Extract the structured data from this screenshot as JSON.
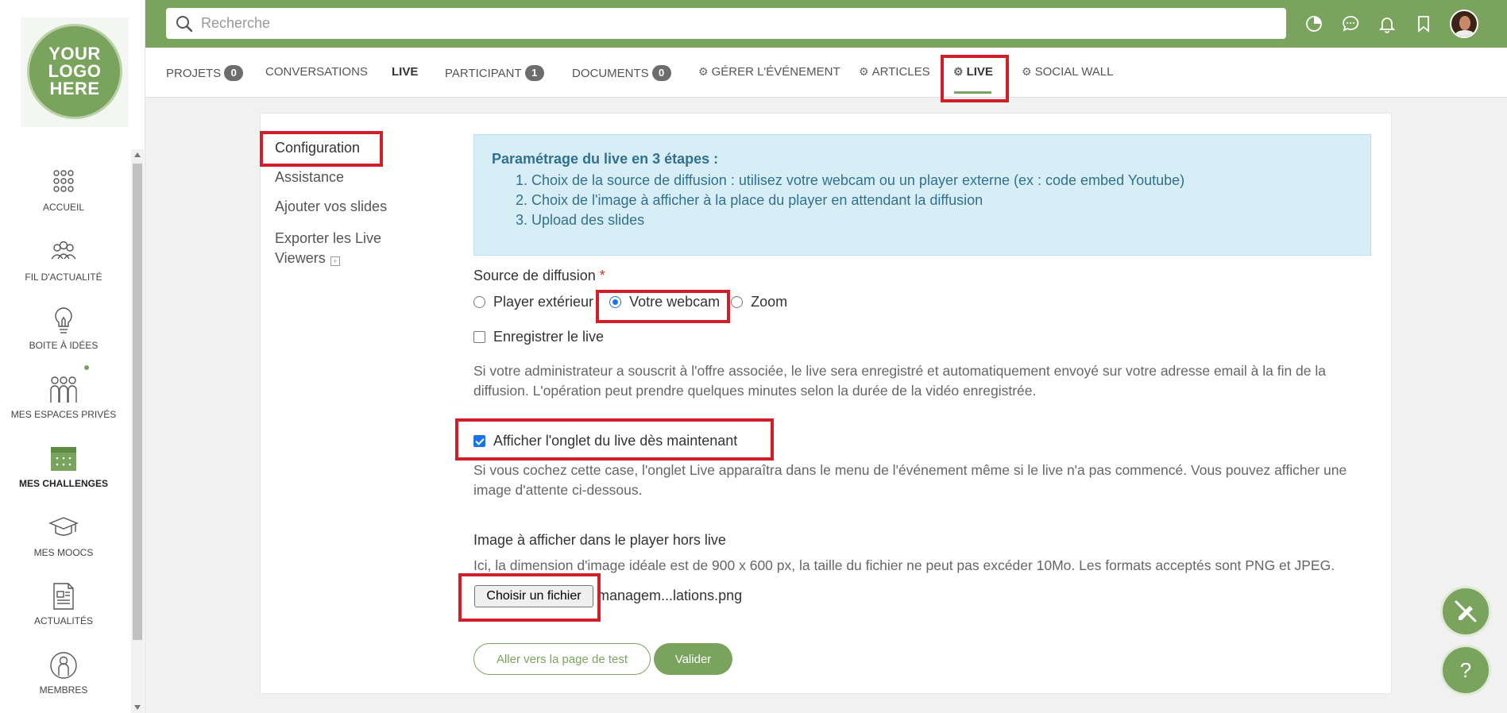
{
  "logo": {
    "lines": [
      "YOUR",
      "LOGO",
      "HERE"
    ]
  },
  "search": {
    "placeholder": "Recherche"
  },
  "sidebar": {
    "items": [
      {
        "label": "ACCUEIL",
        "icon": "grid-dots-icon"
      },
      {
        "label": "FIL D'ACTUALITÉ",
        "icon": "people-group-icon"
      },
      {
        "label": "BOITE À IDÉES",
        "icon": "lightbulb-icon"
      },
      {
        "label": "MES ESPACES PRIVÉS",
        "icon": "people-three-icon"
      },
      {
        "label": "MES CHALLENGES",
        "icon": "calendar-icon"
      },
      {
        "label": "MES MOOCS",
        "icon": "graduation-cap-icon"
      },
      {
        "label": "ACTUALITÉS",
        "icon": "newspaper-icon"
      },
      {
        "label": "MEMBRES",
        "icon": "member-icon"
      }
    ]
  },
  "tabs": {
    "projets": {
      "label": "PROJETS",
      "count": "0"
    },
    "conversations": {
      "label": "CONVERSATIONS"
    },
    "live": {
      "label": "LIVE"
    },
    "participant": {
      "label": "PARTICIPANT",
      "count": "1"
    },
    "documents": {
      "label": "DOCUMENTS",
      "count": "0"
    },
    "gerer": {
      "label": "GÉRER L'ÉVÉNEMENT"
    },
    "articles": {
      "label": "ARTICLES"
    },
    "live_settings": {
      "label": "LIVE"
    },
    "social_wall": {
      "label": "SOCIAL WALL"
    }
  },
  "subnav": {
    "configuration": "Configuration",
    "assistance": "Assistance",
    "slides": "Ajouter vos slides",
    "export_line1": "Exporter les Live",
    "export_line2": "Viewers"
  },
  "info": {
    "title": "Paramétrage du live en 3 étapes :",
    "steps": [
      "Choix de la source de diffusion : utilisez votre webcam ou un player externe (ex : code embed Youtube)",
      "Choix de l'image à afficher à la place du player en attendant la diffusion",
      "Upload des slides"
    ]
  },
  "form": {
    "source_label": "Source de diffusion",
    "required_mark": "*",
    "options": {
      "player": "Player extérieur",
      "webcam": "Votre webcam",
      "zoom": "Zoom"
    },
    "selected_source": "Votre webcam",
    "record_label": "Enregistrer le live",
    "record_checked": false,
    "record_help": "Si votre administrateur a souscrit à l'offre associée, le live sera enregistré et automatiquement envoyé sur votre adresse email à la fin de la diffusion. L'opération peut prendre quelques minutes selon la durée de la vidéo enregistrée.",
    "show_tab_label": "Afficher l'onglet du live dès maintenant",
    "show_tab_checked": true,
    "show_tab_help": "Si vous cochez cette case, l'onglet Live apparaîtra dans le menu de l'événement même si le live n'a pas commencé. Vous pouvez afficher une image d'attente ci-dessous.",
    "image_label": "Image à afficher dans le player hors live",
    "image_help": "Ici, la dimension d'image idéale est de 900 x 600 px, la taille du fichier ne peut pas excéder 10Mo. Les formats acceptés sont PNG et JPEG.",
    "file_button": "Choisir un fichier",
    "file_name": "managem...lations.png"
  },
  "buttons": {
    "test_page": "Aller vers la page de test",
    "validate": "Valider"
  },
  "fab": {
    "help": "?"
  },
  "colors": {
    "brand_green": "#7aa35d",
    "highlight_red": "#d11f2a",
    "info_bg": "#d8eef6",
    "info_text": "#31708f"
  }
}
